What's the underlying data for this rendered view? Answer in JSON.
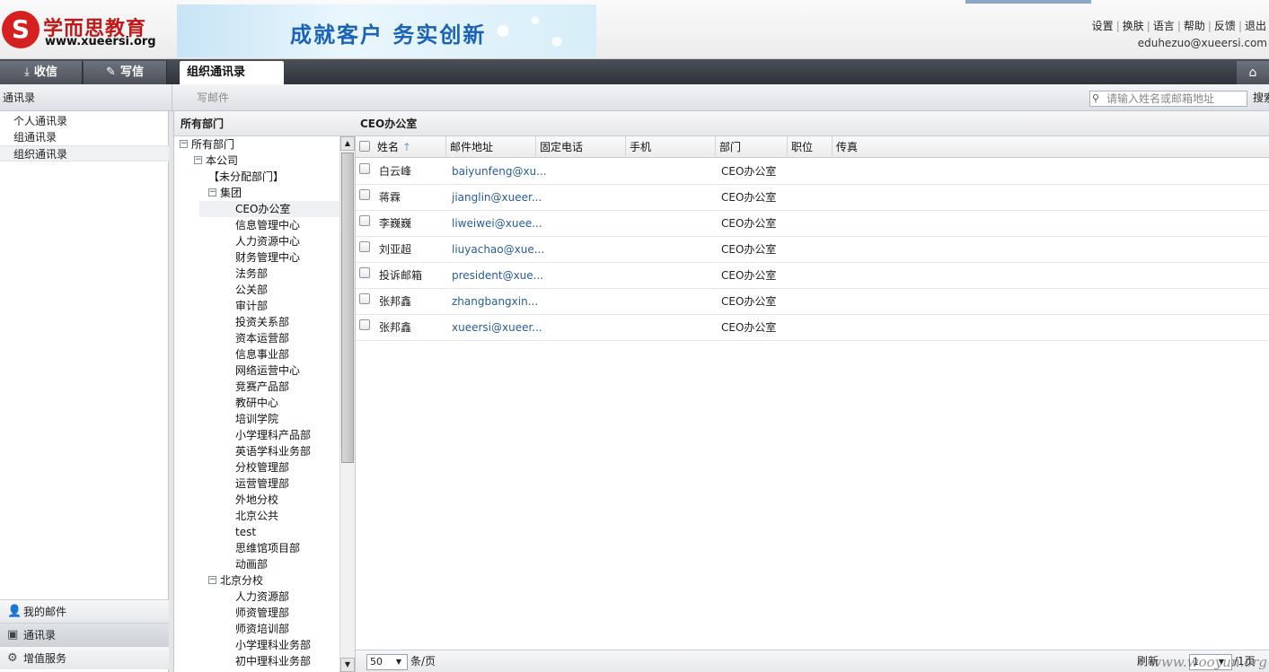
{
  "header": {
    "logo_letter": "S",
    "logo_cn": "学而思教育",
    "logo_en": "www.xueersi.org",
    "banner_text": "成就客户 务实创新",
    "links": [
      "设置",
      "换肤",
      "语言",
      "帮助",
      "反馈",
      "退出"
    ],
    "user_email": "eduhezuo@xueersi.com"
  },
  "tabbar": {
    "inbox": "收信",
    "compose": "写信",
    "active_tab": "组织通讯录",
    "home_icon": "home-icon"
  },
  "toolbar": {
    "section_title": "通讯录",
    "compose_link": "写邮件",
    "search_placeholder": "请输入姓名或邮箱地址",
    "search_button": "搜索"
  },
  "sidebar": {
    "items": [
      "个人通讯录",
      "组通讯录",
      "组织通讯录"
    ],
    "bottom": [
      "我的邮件",
      "通讯录",
      "增值服务"
    ]
  },
  "tree": {
    "header": "所有部门",
    "nodes": [
      {
        "label": "所有部门",
        "level": 0,
        "toggle": "−"
      },
      {
        "label": "本公司",
        "level": 1,
        "toggle": "−"
      },
      {
        "label": "【未分配部门】",
        "level": 2,
        "toggle": ""
      },
      {
        "label": "集团",
        "level": 2,
        "toggle": "−"
      },
      {
        "label": "CEO办公室",
        "level": 3,
        "toggle": "",
        "selected": true
      },
      {
        "label": "信息管理中心",
        "level": 3,
        "toggle": ""
      },
      {
        "label": "人力资源中心",
        "level": 3,
        "toggle": ""
      },
      {
        "label": "财务管理中心",
        "level": 3,
        "toggle": ""
      },
      {
        "label": "法务部",
        "level": 3,
        "toggle": ""
      },
      {
        "label": "公关部",
        "level": 3,
        "toggle": ""
      },
      {
        "label": "审计部",
        "level": 3,
        "toggle": ""
      },
      {
        "label": "投资关系部",
        "level": 3,
        "toggle": ""
      },
      {
        "label": "资本运营部",
        "level": 3,
        "toggle": ""
      },
      {
        "label": "信息事业部",
        "level": 3,
        "toggle": ""
      },
      {
        "label": "网络运营中心",
        "level": 3,
        "toggle": ""
      },
      {
        "label": "竞赛产品部",
        "level": 3,
        "toggle": ""
      },
      {
        "label": "教研中心",
        "level": 3,
        "toggle": ""
      },
      {
        "label": "培训学院",
        "level": 3,
        "toggle": ""
      },
      {
        "label": "小学理科产品部",
        "level": 3,
        "toggle": ""
      },
      {
        "label": "英语学科业务部",
        "level": 3,
        "toggle": ""
      },
      {
        "label": "分校管理部",
        "level": 3,
        "toggle": ""
      },
      {
        "label": "运营管理部",
        "level": 3,
        "toggle": ""
      },
      {
        "label": "外地分校",
        "level": 3,
        "toggle": ""
      },
      {
        "label": "北京公共",
        "level": 3,
        "toggle": ""
      },
      {
        "label": "test",
        "level": 3,
        "toggle": ""
      },
      {
        "label": "思维馆项目部",
        "level": 3,
        "toggle": ""
      },
      {
        "label": "动画部",
        "level": 3,
        "toggle": ""
      },
      {
        "label": "北京分校",
        "level": 2,
        "toggle": "−"
      },
      {
        "label": "人力资源部",
        "level": 3,
        "toggle": ""
      },
      {
        "label": "师资管理部",
        "level": 3,
        "toggle": ""
      },
      {
        "label": "师资培训部",
        "level": 3,
        "toggle": ""
      },
      {
        "label": "小学理科业务部",
        "level": 3,
        "toggle": ""
      },
      {
        "label": "初中理科业务部",
        "level": 3,
        "toggle": ""
      }
    ]
  },
  "grid": {
    "title": "CEO办公室",
    "sort_indicator": "↑",
    "columns": [
      "姓名",
      "邮件地址",
      "固定电话",
      "手机",
      "部门",
      "职位",
      "传真"
    ],
    "rows": [
      {
        "name": "白云峰",
        "email": "baiyunfeng@xu...",
        "dept": "CEO办公室"
      },
      {
        "name": "蒋霖",
        "email": "jianglin@xueer...",
        "dept": "CEO办公室"
      },
      {
        "name": "李巍巍",
        "email": "liweiwei@xuee...",
        "dept": "CEO办公室"
      },
      {
        "name": "刘亚超",
        "email": "liuyachao@xue...",
        "dept": "CEO办公室"
      },
      {
        "name": "投诉邮箱",
        "email": "president@xue...",
        "dept": "CEO办公室"
      },
      {
        "name": "张邦鑫",
        "email": "zhangbangxin...",
        "dept": "CEO办公室"
      },
      {
        "name": "张邦鑫",
        "email": "xueersi@xueer...",
        "dept": "CEO办公室"
      }
    ],
    "footer": {
      "page_size": "50",
      "page_size_unit": "条/页",
      "refresh": "刷新",
      "page_current": "1",
      "page_total": "/1页"
    }
  },
  "watermark": "www.wooyun.org"
}
